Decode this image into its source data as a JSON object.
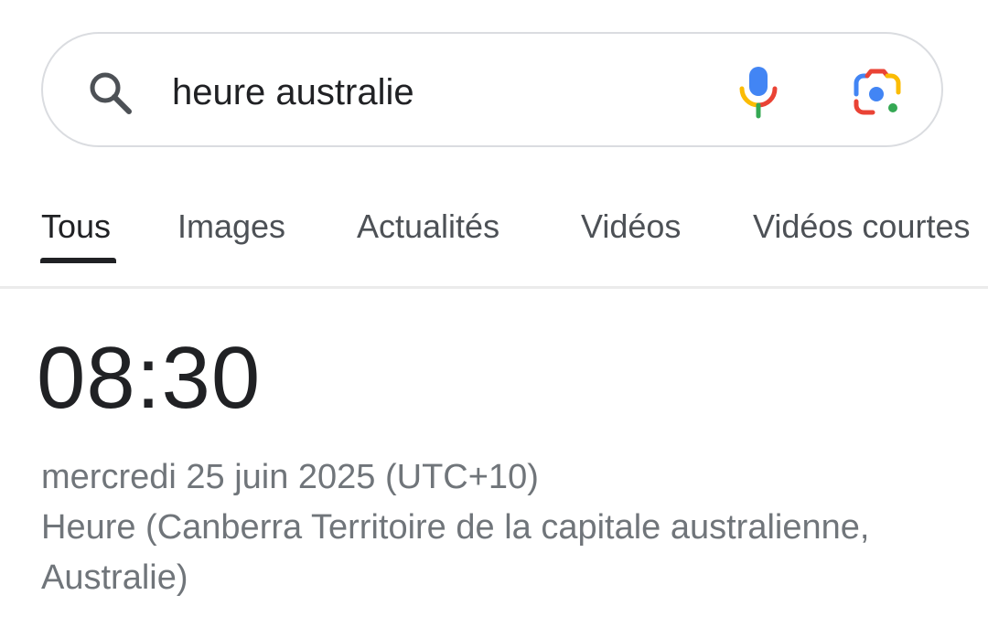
{
  "search": {
    "query": "heure australie",
    "icons": {
      "search": "search-icon",
      "voice": "microphone-icon",
      "lens": "google-lens-icon"
    }
  },
  "tabs": [
    {
      "label": "Tous",
      "active": true
    },
    {
      "label": "Images",
      "active": false
    },
    {
      "label": "Actualités",
      "active": false
    },
    {
      "label": "Vidéos",
      "active": false
    },
    {
      "label": "Vidéos courtes",
      "active": false
    }
  ],
  "result": {
    "time": "08:30",
    "date": "mercredi 25 juin 2025 (UTC+10)",
    "location": "Heure (Canberra Territoire de la capitale australienne, Australie)"
  },
  "colors": {
    "blue": "#4285f4",
    "red": "#ea4335",
    "yellow": "#fbbc04",
    "green": "#34a853",
    "text_primary": "#202124",
    "text_secondary": "#70757a"
  }
}
